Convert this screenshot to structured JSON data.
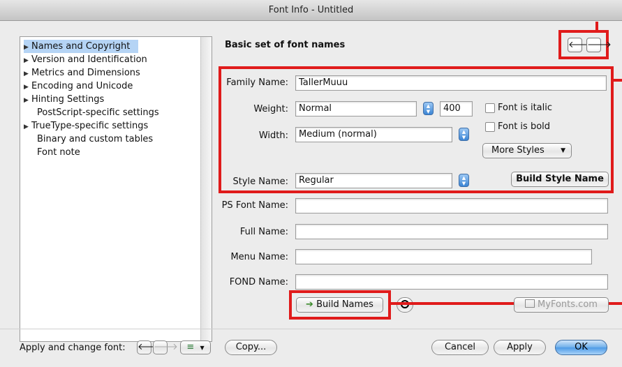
{
  "window": {
    "title": "Font Info - Untitled"
  },
  "outline": {
    "items": [
      {
        "label": "Names and Copyright",
        "expandable": true,
        "selected": true
      },
      {
        "label": "Version and Identification",
        "expandable": true
      },
      {
        "label": "Metrics and Dimensions",
        "expandable": true
      },
      {
        "label": "Encoding and Unicode",
        "expandable": true
      },
      {
        "label": "Hinting Settings",
        "expandable": true
      },
      {
        "label": "PostScript-specific settings",
        "expandable": false
      },
      {
        "label": "TrueType-specific settings",
        "expandable": true
      },
      {
        "label": "Binary and custom tables",
        "expandable": false
      },
      {
        "label": "Font note",
        "expandable": false
      }
    ]
  },
  "header": {
    "title": "Basic set of font names",
    "prev_icon": "arrow-left-icon",
    "next_icon": "arrow-right-icon",
    "prev_glyph": "🡐",
    "next_glyph": "🡒"
  },
  "form": {
    "family_name_label": "Family Name:",
    "family_name_value": "TallerMuuu",
    "weight_label": "Weight:",
    "weight_value": "Normal",
    "weight_number": "400",
    "italic_label": "Font is italic",
    "bold_label": "Font is bold",
    "width_label": "Width:",
    "width_value": "Medium (normal)",
    "more_styles_label": "More Styles",
    "style_name_label": "Style Name:",
    "style_name_value": "Regular",
    "build_style_name_label": "Build Style Name",
    "ps_font_name_label": "PS Font Name:",
    "ps_font_name_value": "",
    "full_name_label": "Full Name:",
    "full_name_value": "",
    "menu_name_label": "Menu Name:",
    "menu_name_value": "",
    "fond_name_label": "FOND Name:",
    "fond_name_value": "",
    "build_names_label": "Build Names",
    "myfonts_label": "MyFonts.com"
  },
  "footer": {
    "apply_change_label": "Apply and change font:",
    "copy_label": "Copy...",
    "cancel_label": "Cancel",
    "apply_label": "Apply",
    "ok_label": "OK"
  },
  "colors": {
    "annotation": "#e01b1b",
    "selection": "#b5d4f5",
    "accent": "#4d9ae6"
  }
}
